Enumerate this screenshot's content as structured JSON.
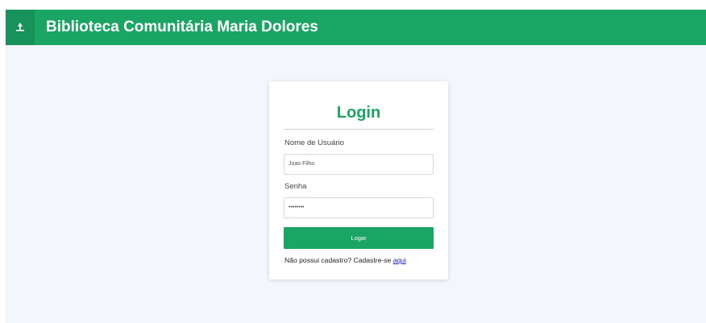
{
  "header": {
    "title": "Biblioteca Comunitária Maria Dolores",
    "logo_icon": "library-icon",
    "background": "#1aa564"
  },
  "login": {
    "title": "Login",
    "username_label": "Nome de Usuário",
    "username_value": "Joao Filho",
    "password_label": "Senha",
    "password_value": "••••••••",
    "submit_label": "Logar",
    "register_prompt": "Não possui cadastro? Cadastre-se ",
    "register_link": "aqui"
  },
  "colors": {
    "accent": "#1aa564",
    "page_background": "#f3f7fc",
    "link": "#1a1acc"
  }
}
